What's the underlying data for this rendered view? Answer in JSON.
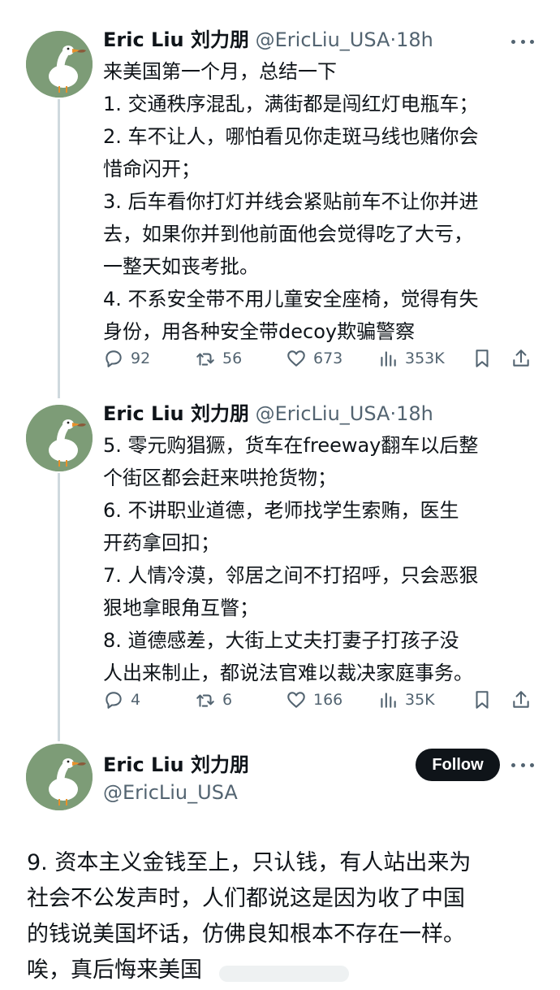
{
  "tweets": [
    {
      "name": "Eric Liu 刘力朋",
      "handle": "@EricLiu_USA",
      "separator": "·",
      "time": "18h",
      "lines": [
        "来美国第一个月，总结一下",
        "1. 交通秩序混乱，满街都是闯红灯电瓶车；",
        "2. 车不让人，哪怕看见你走斑马线也赌你会",
        "惜命闪开；",
        "3. 后车看你打灯并线会紧贴前车不让你并进",
        "去，如果你并到他前面他会觉得吃了大亏，",
        "一整天如丧考批。",
        "4. 不系安全带不用儿童安全座椅，觉得有失",
        "身份，用各种安全带decoy欺骗警察"
      ],
      "stats": {
        "replies": "92",
        "retweets": "56",
        "likes": "673",
        "views": "353K"
      }
    },
    {
      "name": "Eric Liu 刘力朋",
      "handle": "@EricLiu_USA",
      "separator": "·",
      "time": "18h",
      "lines": [
        "5. 零元购猖獗，货车在freeway翻车以后整",
        "个街区都会赶来哄抢货物；",
        "6. 不讲职业道德，老师找学生索贿，医生",
        "开药拿回扣；",
        "7. 人情冷漠，邻居之间不打招呼，只会恶狠",
        "狠地拿眼角互瞥；",
        "8. 道德感差，大街上丈夫打妻子打孩子没",
        "人出来制止，都说法官难以裁决家庭事务。"
      ],
      "stats": {
        "replies": "4",
        "retweets": "6",
        "likes": "166",
        "views": "35K"
      }
    }
  ],
  "main_tweet": {
    "name": "Eric Liu 刘力朋",
    "handle": "@EricLiu_USA",
    "follow_label": "Follow",
    "lines": [
      "9. 资本主义金钱至上，只认钱，有人站出来为",
      "社会不公发声时，人们都说这是因为收了中国",
      "的钱说美国坏话，仿佛良知根本不存在一样。",
      "唉，真后悔来美国"
    ]
  },
  "colors": {
    "text": "#0f1419",
    "secondary": "#536471",
    "thread_line": "#cfd9de",
    "avatar_bg": "#7d9c77",
    "follow_bg": "#0f1419"
  },
  "icons": [
    "reply-icon",
    "retweet-icon",
    "like-icon",
    "views-icon",
    "bookmark-icon",
    "share-icon",
    "more-icon",
    "goose-avatar"
  ]
}
